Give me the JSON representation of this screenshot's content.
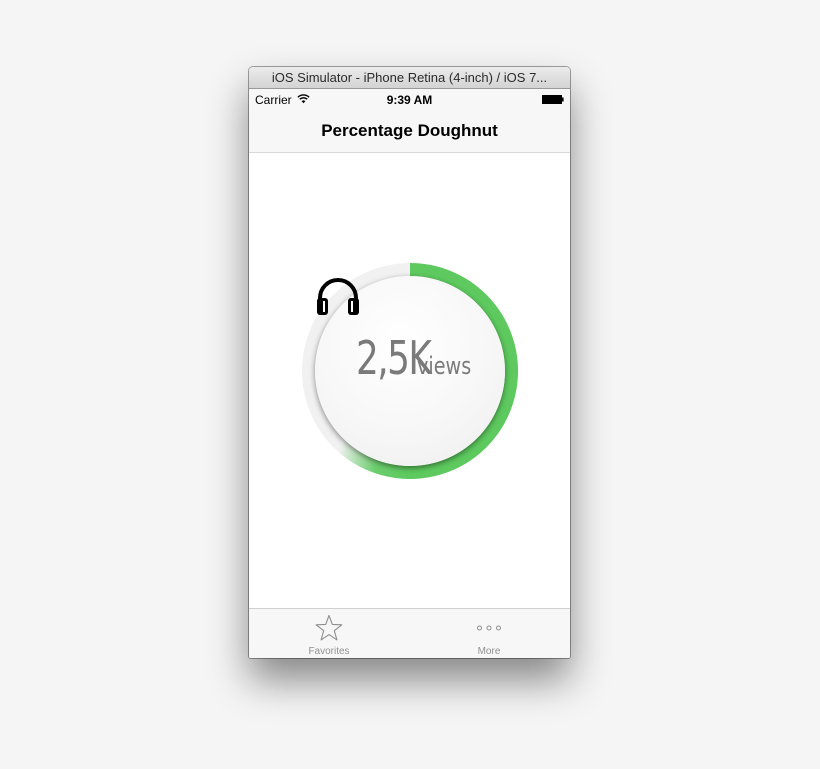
{
  "window": {
    "title": "iOS Simulator - iPhone Retina (4-inch) / iOS 7..."
  },
  "status_bar": {
    "carrier": "Carrier",
    "time": "9:39 AM",
    "wifi_icon": "wifi-icon",
    "battery_icon": "battery-icon"
  },
  "nav": {
    "title": "Percentage Doughnut"
  },
  "doughnut": {
    "percentage": 0.62,
    "value_label": "2,5K",
    "unit_label": "views",
    "icon": "headphones-icon",
    "colors": {
      "progress": "#5dc95e",
      "track": "#f1f1f1",
      "text": "#7a7a7a"
    }
  },
  "tab_bar": {
    "items": [
      {
        "label": "Favorites",
        "icon": "star-icon"
      },
      {
        "label": "More",
        "icon": "more-icon"
      }
    ]
  }
}
